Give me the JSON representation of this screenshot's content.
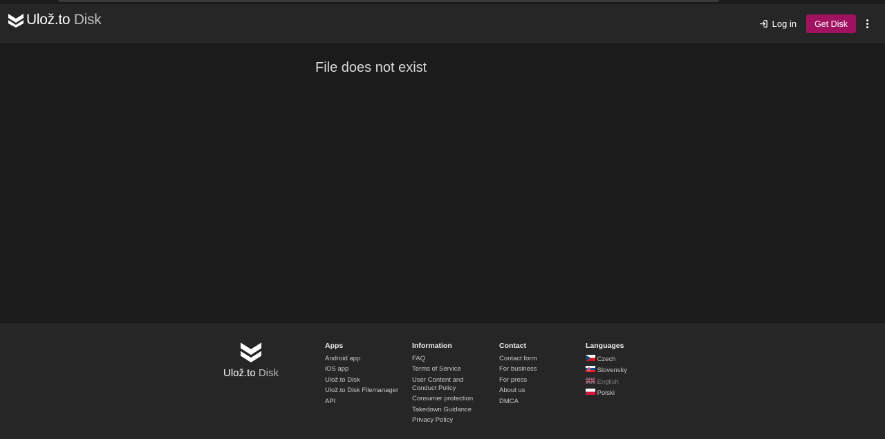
{
  "header": {
    "logo_main": "Ulož.to",
    "logo_disk": "Disk",
    "login_label": "Log in",
    "cta_label": "Get Disk"
  },
  "main": {
    "message": "File does not exist"
  },
  "footer": {
    "logo_main": "Ulož.to",
    "logo_disk": "Disk",
    "apps": {
      "title": "Apps",
      "items": [
        "Android app",
        "iOS app",
        "Ulož.to Disk",
        "Ulož.to Disk Filemanager",
        "API"
      ]
    },
    "information": {
      "title": "Information",
      "items": [
        "FAQ",
        "Terms of Service",
        "User Content and Conduct Policy",
        "Consumer protection",
        "Takedown Guidance",
        "Privacy Policy"
      ]
    },
    "contact": {
      "title": "Contact",
      "items": [
        "Contact form",
        "For business",
        "For press",
        "About us",
        "DMCA"
      ]
    },
    "languages": {
      "title": "Languages",
      "items": [
        "Czech",
        "Slovensky",
        "English",
        "Polski"
      ],
      "flags": [
        "cz-flag-icon",
        "sk-flag-icon",
        "uk-flag-icon",
        "pl-flag-icon"
      ],
      "active": "English"
    }
  },
  "colors": {
    "accent": "#a0125f",
    "background": "#1b1b1b",
    "header": "#262626"
  }
}
